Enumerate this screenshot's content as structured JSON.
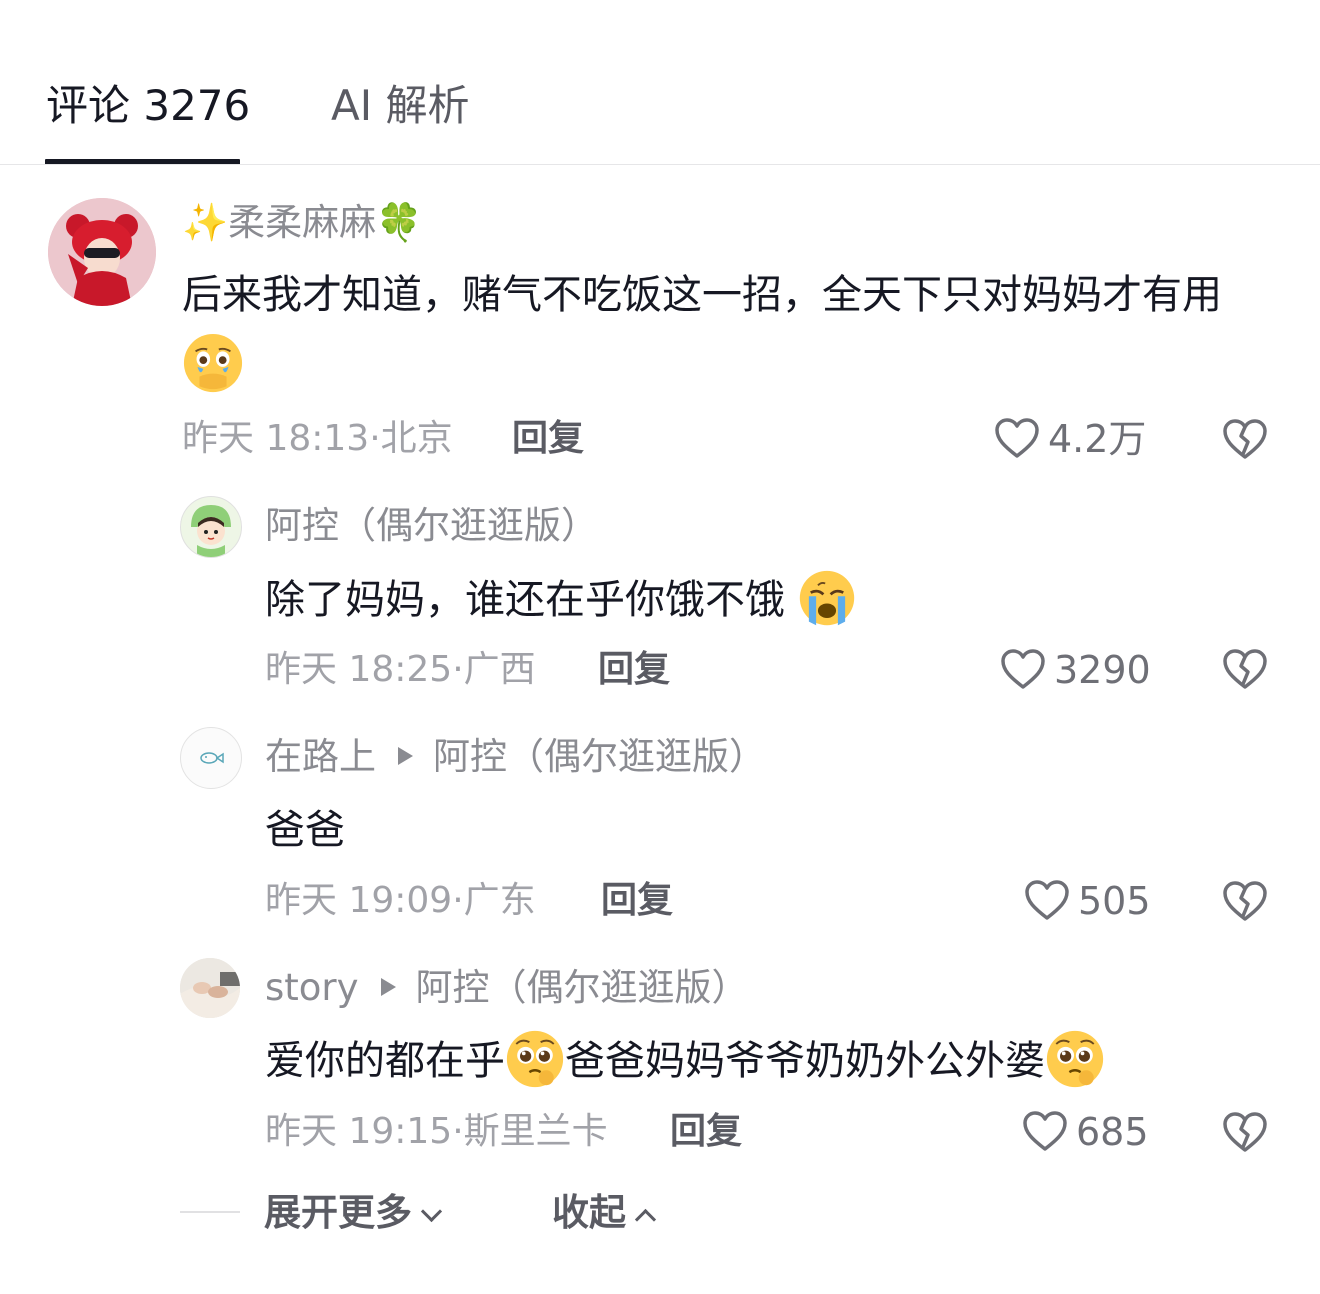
{
  "tabs": [
    {
      "label": "评论 3276",
      "active": true
    },
    {
      "label": "AI 解析",
      "active": false
    }
  ],
  "comments": [
    {
      "username_prefix": "✨",
      "username": "柔柔麻麻",
      "username_suffix": "🍀",
      "text": "后来我才知道，赌气不吃饭这一招，全天下只对妈妈才有用",
      "emoji": "face-holding-back-tears-emoji",
      "time": "昨天 18:13",
      "location": "北京",
      "reply_label": "回复",
      "likes": "4.2万",
      "avatar": "girl-red-hat-avatar"
    },
    {
      "username": "阿控（偶尔逛逛版）",
      "text": "除了妈妈，谁还在乎你饿不饿",
      "emoji": "loudly-crying-face-emoji",
      "time": "昨天 18:25",
      "location": "广西",
      "reply_label": "回复",
      "likes": "3290",
      "avatar": "cartoon-boy-dino-hood-avatar"
    },
    {
      "username": "在路上",
      "reply_to": "阿控（偶尔逛逛版）",
      "text": "爸爸",
      "time": "昨天 19:09",
      "location": "广东",
      "reply_label": "回复",
      "likes": "505",
      "avatar": "fish-doodle-avatar"
    },
    {
      "username": "story",
      "reply_to": "阿控（偶尔逛逛版）",
      "text_part1": "爱你的都在乎",
      "text_part2": "爸爸妈妈爷爷奶奶外公外婆",
      "emoji": "pleading-face-emoji",
      "time": "昨天 19:15",
      "location": "斯里兰卡",
      "reply_label": "回复",
      "likes": "685",
      "avatar": "hands-photo-avatar"
    }
  ],
  "expand_label": "展开更多",
  "collapse_label": "收起",
  "colors": {
    "text_primary": "#161823",
    "text_secondary": "#8a8b91",
    "text_meta": "#a1a2a8",
    "divider": "#e6e6e8"
  }
}
